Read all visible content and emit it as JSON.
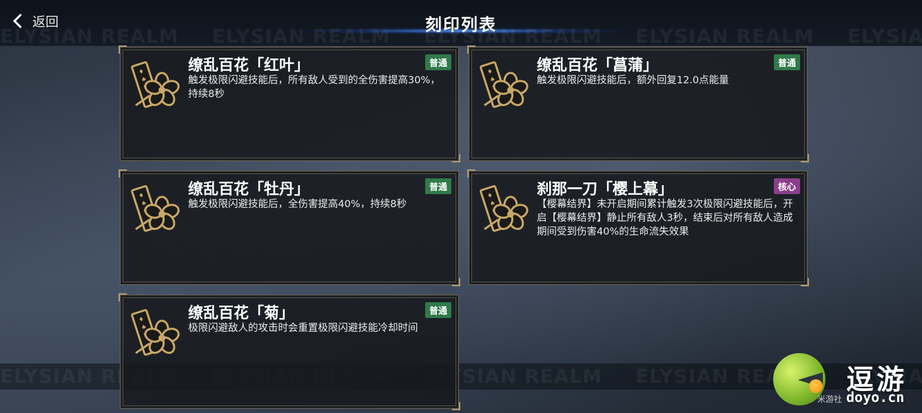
{
  "header": {
    "back_label": "返回",
    "title": "刻印列表"
  },
  "watermark": {
    "text": "ELYSIAN REALM"
  },
  "cards": [
    {
      "title": "缭乱百花「红叶」",
      "badge": "普通",
      "badge_type": "normal",
      "desc": "触发极限闪避技能后，所有敌人受到的全伤害提高30%，持续8秒"
    },
    {
      "title": "缭乱百花「菖蒲」",
      "badge": "普通",
      "badge_type": "normal",
      "desc": "触发极限闪避技能后，额外回复12.0点能量"
    },
    {
      "title": "缭乱百花「牡丹」",
      "badge": "普通",
      "badge_type": "normal",
      "desc": "触发极限闪避技能后，全伤害提高40%，持续8秒"
    },
    {
      "title": "刹那一刀「樱上幕」",
      "badge": "核心",
      "badge_type": "core",
      "desc": "【樱幕结界】未开启期间累计触发3次极限闪避技能后，开启【樱幕结界】静止所有敌人3秒，结束后对所有敌人造成期间受到伤害40%的生命流失效果"
    },
    {
      "title": "缭乱百花「菊」",
      "badge": "普通",
      "badge_type": "normal",
      "desc": "极限闪避敌人的攻击时会重置极限闪避技能冷却时间"
    }
  ],
  "logo": {
    "name": "逗游",
    "domain": "doyo.cn",
    "sub": "米游社"
  },
  "colors": {
    "badge_normal": "#2f7a4a",
    "badge_core": "#8a3f8c",
    "card_border": "#6e6656",
    "icon_gold": "#c9a866"
  }
}
